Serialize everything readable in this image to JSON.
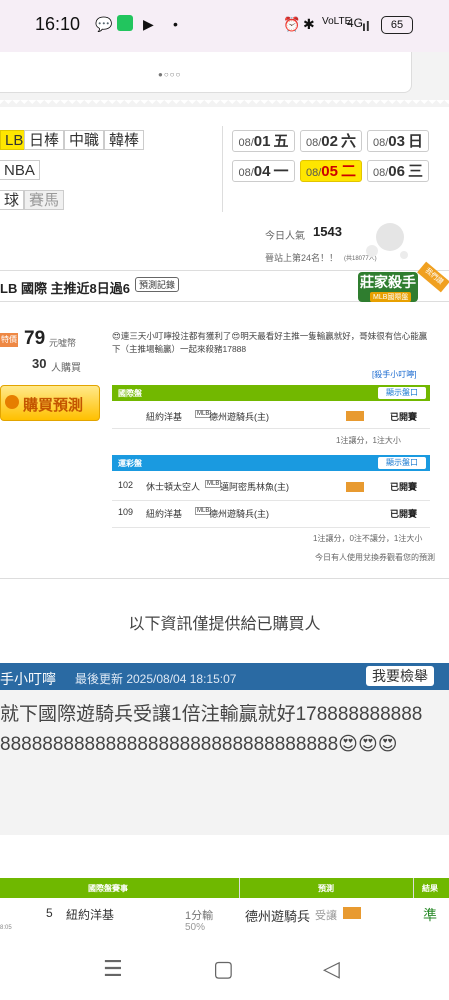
{
  "status_bar": {
    "time": "16:10",
    "battery": "65",
    "signal": "4G"
  },
  "nav": {
    "sports": [
      "LB",
      "日棒",
      "中職",
      "韓棒",
      "NBA",
      "球",
      "賽馬"
    ],
    "dates": [
      {
        "md": "08/",
        "d": "01",
        "w": "五"
      },
      {
        "md": "08/",
        "d": "02",
        "w": "六"
      },
      {
        "md": "08/",
        "d": "03",
        "w": "日"
      },
      {
        "md": "08/",
        "d": "04",
        "w": "一"
      },
      {
        "md": "08/",
        "d": "05",
        "w": "二"
      },
      {
        "md": "08/",
        "d": "06",
        "w": "三"
      }
    ],
    "active_date_index": 4
  },
  "stats": {
    "today_label": "今日人氣",
    "today_count": "1543",
    "rank_text": "晉站上第24名！！",
    "rank_small": "(共18077人)"
  },
  "title_bar": {
    "text": "LB 國際 主推近8日過6",
    "record_button": "預測記錄",
    "badge": "莊家殺手",
    "badge_sub": "MLB國際盤",
    "ribbon": "我們讚"
  },
  "offer": {
    "price": "79",
    "price_unit": "元噓幣",
    "buyers": "30",
    "buyers_unit": "人購買",
    "buy_button": "購買預測",
    "price_tag": "特價"
  },
  "message": {
    "text": "😍連三天小叮嚀投注都有獲利了😍明天最看好主推一隻輸贏就好，哥妹很有信心能贏下（主推場輸贏）一起來殺豬17888",
    "link": "[殺手小叮嚀]"
  },
  "tables": [
    {
      "title": "國際盤",
      "show_button": "顯示盤口",
      "rows": [
        {
          "no": "",
          "away": "紐約洋基",
          "league": "MLB",
          "home": "德州遊騎兵(主)",
          "tag": "主推",
          "status": "已開賽"
        }
      ],
      "footer": "1注讓分，1注大小"
    },
    {
      "title": "運彩盤",
      "show_button": "顯示盤口",
      "rows": [
        {
          "no": "102",
          "away": "休士頓太空人",
          "league": "MLB",
          "home": "邁阿密馬林魚(主)",
          "tag": "主推",
          "status": "已開賽"
        },
        {
          "no": "109",
          "away": "紐約洋基",
          "league": "MLB",
          "home": "德州遊騎兵(主)",
          "tag": "",
          "status": "已開賽"
        }
      ],
      "footer": "1注讓分，0注不讓分，1注大小"
    }
  ],
  "redeem_note": "今日有人使用兌換券觀看您的預測",
  "center_message": "以下資訊僅提供給已購買人",
  "announcement": {
    "title": "手小叮嚀",
    "updated": "最後更新 2025/08/04 18:15:07",
    "report_button": "我要檢舉",
    "line1": "就下國際遊騎兵受讓1倍注輸贏就好178888888888",
    "line2": "88888888888888888888888888888888😍😍😍"
  },
  "bottom_table": {
    "headers": [
      "國際盤賽事",
      "預測",
      "結果"
    ],
    "row": {
      "time": "8:05",
      "no": "5",
      "team": "紐約洋基",
      "line": "1分輸",
      "pct": "50%",
      "pick": "德州遊騎兵",
      "pick_type": "受讓",
      "tag": "主推",
      "result": "準"
    }
  },
  "colors": {
    "accent_yellow": "#ffe600",
    "green": "#72b800",
    "blue": "#1a9ae0",
    "announce_blue": "#2a6aa3"
  }
}
